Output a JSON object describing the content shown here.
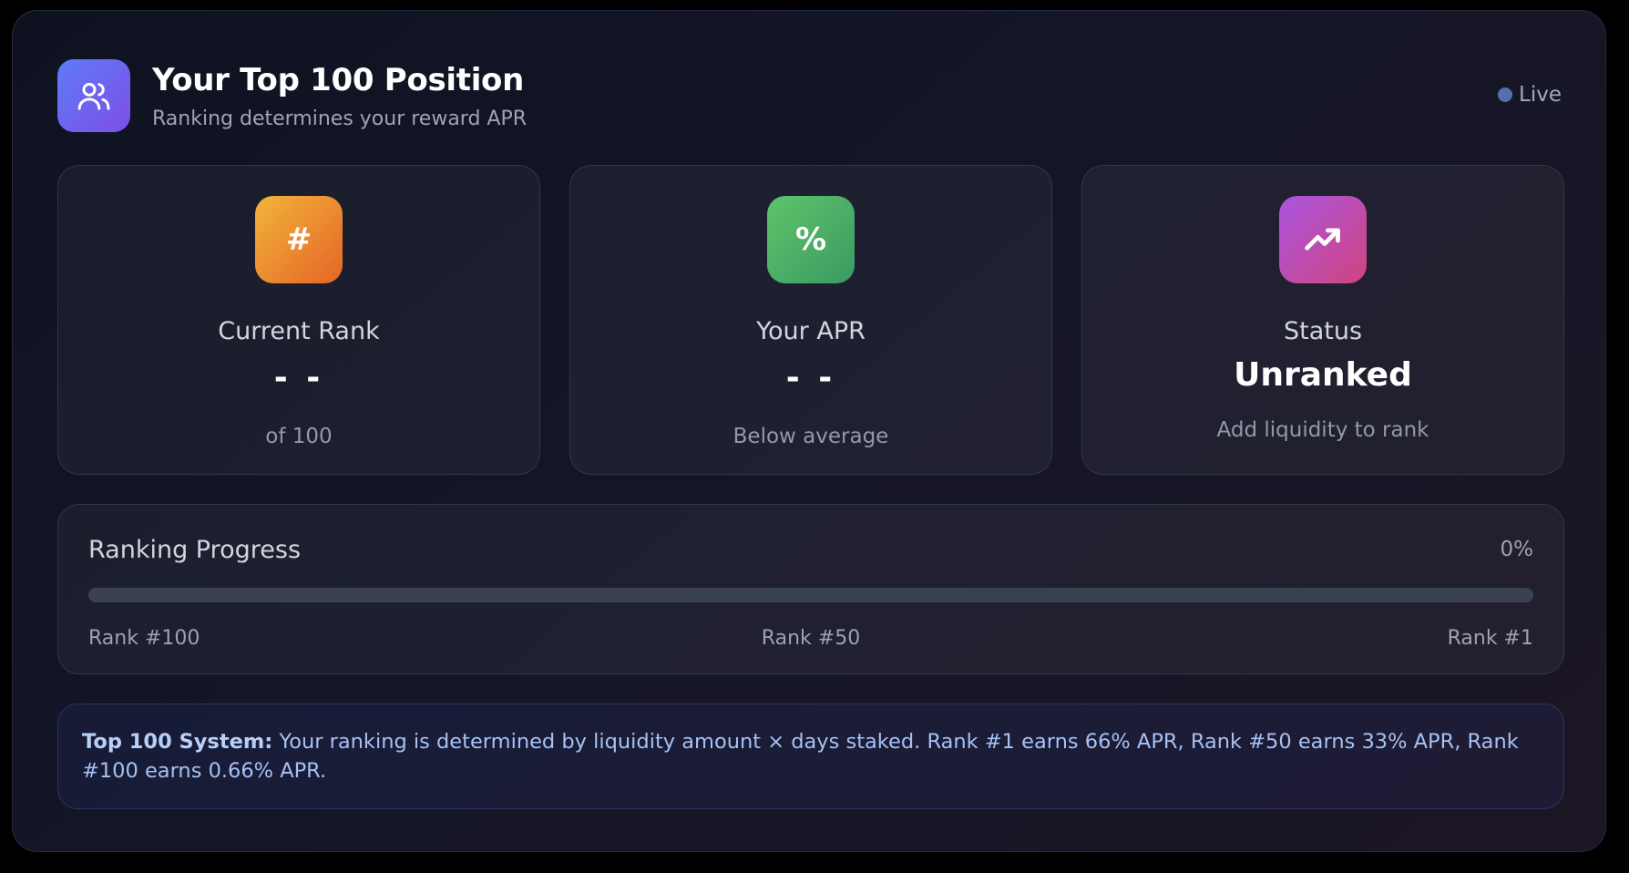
{
  "header": {
    "icon": "users-icon",
    "title": "Your Top 100 Position",
    "subtitle": "Ranking determines your reward APR",
    "live_label": "Live",
    "live_color": "#5370ad"
  },
  "stats": [
    {
      "icon": "hash-icon",
      "icon_glyph": "#",
      "label": "Current Rank",
      "value": "- -",
      "sub": "of 100"
    },
    {
      "icon": "percent-icon",
      "icon_glyph": "%",
      "label": "Your APR",
      "value": "- -",
      "sub": "Below average"
    },
    {
      "icon": "trending-up-icon",
      "label": "Status",
      "value": "Unranked",
      "sub": "Add liquidity to rank"
    }
  ],
  "progress": {
    "title": "Ranking Progress",
    "percent_label": "0%",
    "percent": 0,
    "ticks": [
      "Rank #100",
      "Rank #50",
      "Rank #1"
    ]
  },
  "info": {
    "bold_label": "Top 100 System:",
    "text": " Your ranking is determined by liquidity amount × days staked. Rank #1 earns 66% APR, Rank #50 earns 33% APR, Rank #100 earns 0.66% APR."
  },
  "colors": {
    "accent_gradient_start": "#5d7bf5",
    "accent_gradient_end": "#7e4fe8",
    "rank_gradient": [
      "#f2b43b",
      "#e56527"
    ],
    "apr_gradient": [
      "#5ec46a",
      "#3b9a63"
    ],
    "status_gradient": [
      "#a955e0",
      "#d1447e"
    ],
    "info_text": "#a6c1f2"
  }
}
